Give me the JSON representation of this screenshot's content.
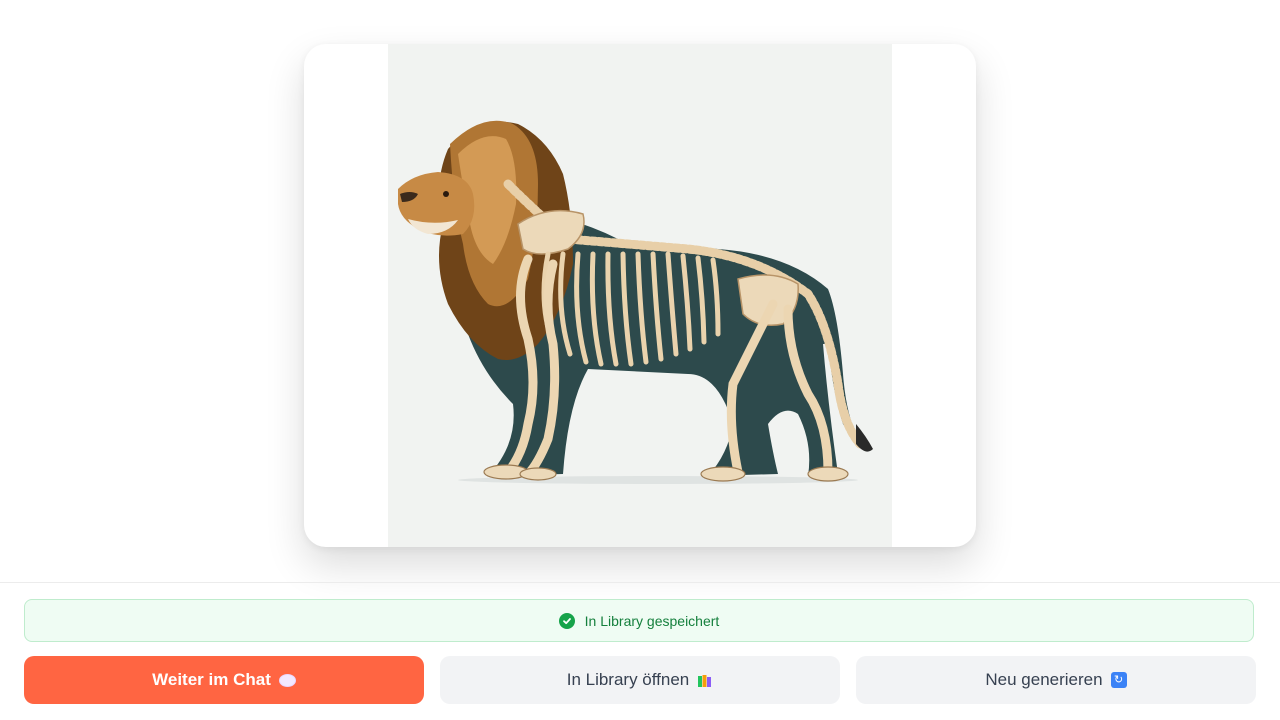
{
  "status": {
    "text": "In Library gespeichert",
    "icon": "check-circle-icon",
    "color": "#15803d"
  },
  "actions": {
    "continue_chat": {
      "label": "Weiter im Chat",
      "icon": "speech-bubble-icon",
      "color": "#ff6542"
    },
    "open_library": {
      "label": "In Library öffnen",
      "icon": "books-icon"
    },
    "regenerate": {
      "label": "Neu generieren",
      "icon": "refresh-icon"
    }
  },
  "preview": {
    "icon": "generated-image-lion-skeleton"
  }
}
